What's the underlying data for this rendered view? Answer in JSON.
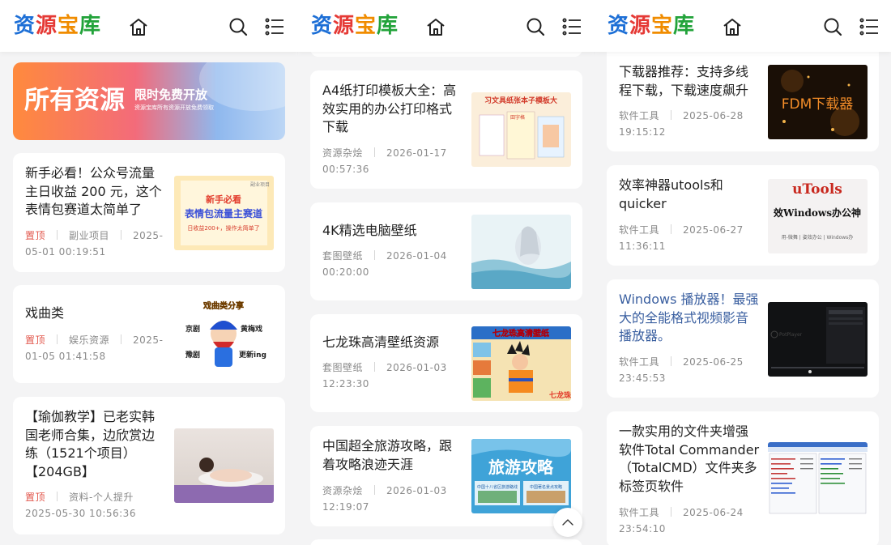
{
  "site": {
    "logo_chars": [
      "资",
      "源",
      "宝",
      "库"
    ],
    "logo_colors": [
      "#1d6fd6",
      "#e53935",
      "#f08c00",
      "#22a33a"
    ]
  },
  "header_icons": [
    "home-icon",
    "search-icon",
    "menu-list-icon"
  ],
  "banner": {
    "headline": "所有资源",
    "tagline": "限时免费开放",
    "subline": "资源宝库所有资源开放免费领取"
  },
  "columns": [
    {
      "cards": [
        {
          "title": "新手必看！公众号流量主日收益 200 元，这个表情包赛道太简单了",
          "pin": "置顶",
          "category": "副业项目",
          "datetime_line1": "2025-",
          "datetime_line2": "05-01 00:19:51",
          "thumb": {
            "tag": "副业项目",
            "line1": "新手必看",
            "line2": "表情包流量主赛道",
            "line3": "日收益200+，操作太简单了"
          }
        },
        {
          "title": "戏曲类",
          "pin": "置顶",
          "category": "娱乐资源",
          "datetime_line1": "2025-",
          "datetime_line2": "01-05 01:41:58",
          "thumb": {
            "heading": "戏曲类分享",
            "l1": "京剧",
            "l2": "黄梅戏",
            "l3": "豫剧",
            "l4": "更新ing"
          }
        },
        {
          "title": "【瑜伽教学】已老实韩国老师合集，边欣赏边练（1521个项目）【204GB】",
          "pin": "置顶",
          "category": "资料-个人提升",
          "datetime_line1": "2025-05-30 10:56:36",
          "datetime_line2": ""
        }
      ]
    },
    {
      "cards": [
        {
          "title": "A4纸打印模板大全：高效实用的办公打印格式下载",
          "category": "资源杂烩",
          "date": "2026-01-17",
          "time": "00:57:36",
          "thumb": {
            "text": "习文具纸张本子模板大",
            "tag": "田字格"
          }
        },
        {
          "title": "4K精选电脑壁纸",
          "category": "套图壁纸",
          "date": "2026-01-04",
          "time": "00:20:00"
        },
        {
          "title": "七龙珠高清壁纸资源",
          "category": "套图壁纸",
          "date": "2026-01-03",
          "time": "12:23:30",
          "thumb": {
            "text": "七龙珠高清壁纸",
            "corner": "七龙珠"
          }
        },
        {
          "title": "中国超全旅游攻略，跟着攻略浪迹天涯",
          "category": "资源杂烩",
          "date": "2026-01-03",
          "time": "12:19:07",
          "thumb": {
            "text": "旅游攻略",
            "tag1": "中国十八省区旅游路线",
            "tag2": "中国著名景点攻略"
          }
        }
      ]
    },
    {
      "cards": [
        {
          "title": "下载器推荐：支持多线程下载，下载速度飙升",
          "category": "软件工具",
          "date": "2025-06-28",
          "time": "19:15:12",
          "thumb": {
            "text": "FDM下载器"
          }
        },
        {
          "title": "效率神器utools和quicker",
          "category": "软件工具",
          "date": "2025-06-27",
          "time": "11:36:11",
          "thumb": {
            "line1": "uTools",
            "line2": "效Windows办公神",
            "line3": "用-微舞 | 姿效办公 | Windows办"
          }
        },
        {
          "title": "Windows 播放器！最强大的全能格式视频影音播放器。",
          "category": "软件工具",
          "date": "2025-06-25",
          "time": "23:45:53",
          "thumb": {
            "text": "PotPlayer"
          }
        },
        {
          "title": "一款实用的文件夹增强软件Total Commander（TotalCMD）文件夹多标签页软件",
          "category": "软件工具",
          "date": "2025-06-24",
          "time": "23:54:10"
        }
      ]
    }
  ],
  "back_to_top_icon": "chevron-up-icon"
}
